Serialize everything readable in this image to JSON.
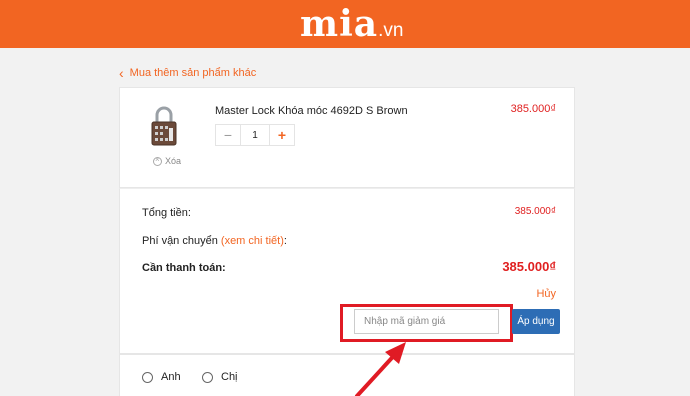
{
  "header": {
    "logo_text": "mia",
    "logo_tld": ".vn",
    "brand_color": "#f26522"
  },
  "nav": {
    "back_label": "Mua thêm sản phẩm khác"
  },
  "cart": {
    "item": {
      "name": "Master Lock Khóa móc 4692D S Brown",
      "price": "385.000₫",
      "quantity": "1",
      "remove_label": "Xóa",
      "minus_label": "−",
      "plus_label": "+"
    }
  },
  "summary": {
    "total_label": "Tổng tiền:",
    "total_value": "385.000₫",
    "shipping_label": "Phí vận chuyển",
    "shipping_link": "(xem chi tiết)",
    "shipping_colon": ":",
    "pay_label": "Cần thanh toán:",
    "pay_value": "385.000₫",
    "cancel_label": "Hủy"
  },
  "coupon": {
    "placeholder": "Nhập mã giảm giá",
    "apply_label": "Áp dụng",
    "apply_color": "#2d6db5"
  },
  "gender": {
    "options": [
      "Anh",
      "Chị"
    ]
  },
  "annotation": {
    "highlight_color": "#e01b24"
  }
}
